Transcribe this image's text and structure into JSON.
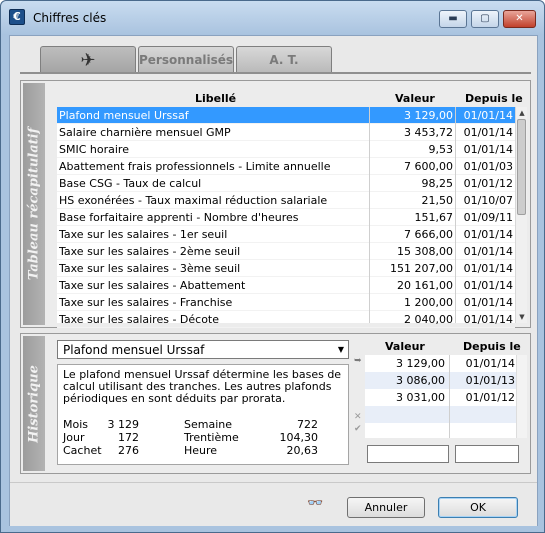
{
  "window": {
    "title": "Chiffres clés",
    "app_icon": "€",
    "controls": {
      "minimize": "▬",
      "maximize": "▢",
      "close": "✕"
    }
  },
  "tabs": [
    {
      "label": "",
      "icon": "airplane-icon",
      "active": true
    },
    {
      "label": "Personnalisés",
      "active": false
    },
    {
      "label": "A. T.",
      "active": false
    }
  ],
  "summary": {
    "side_label": "Tableau récapitulatif",
    "columns": {
      "label": "Libellé",
      "value": "Valeur",
      "since": "Depuis le"
    },
    "rows": [
      {
        "label": "Plafond mensuel Urssaf",
        "value": "3 129,00",
        "since": "01/01/14",
        "selected": true
      },
      {
        "label": "Salaire charnière mensuel GMP",
        "value": "3 453,72",
        "since": "01/01/14"
      },
      {
        "label": "SMIC horaire",
        "value": "9,53",
        "since": "01/01/14"
      },
      {
        "label": "Abattement frais professionnels - Limite annuelle",
        "value": "7 600,00",
        "since": "01/01/03"
      },
      {
        "label": "Base CSG - Taux de calcul",
        "value": "98,25",
        "since": "01/01/12"
      },
      {
        "label": "HS exonérées - Taux maximal réduction salariale",
        "value": "21,50",
        "since": "01/10/07"
      },
      {
        "label": "Base forfaitaire apprenti - Nombre d'heures",
        "value": "151,67",
        "since": "01/09/11"
      },
      {
        "label": "Taxe sur les salaires - 1er seuil",
        "value": "7 666,00",
        "since": "01/01/14"
      },
      {
        "label": "Taxe sur les salaires - 2ème seuil",
        "value": "15 308,00",
        "since": "01/01/14"
      },
      {
        "label": "Taxe sur les salaires - 3ème seuil",
        "value": "151 207,00",
        "since": "01/01/14"
      },
      {
        "label": "Taxe sur les salaires - Abattement",
        "value": "20 161,00",
        "since": "01/01/14"
      },
      {
        "label": "Taxe sur les salaires - Franchise",
        "value": "1 200,00",
        "since": "01/01/14"
      },
      {
        "label": "Taxe sur les salaires - Décote",
        "value": "2 040,00",
        "since": "01/01/14"
      }
    ]
  },
  "history": {
    "side_label": "Historique",
    "selected": "Plafond mensuel Urssaf",
    "description": "Le plafond mensuel Urssaf détermine les bases de calcul utilisant des tranches. Les autres plafonds périodiques en sont déduits par prorata.",
    "periods": [
      {
        "name": "Mois",
        "value": "3 129"
      },
      {
        "name": "Jour",
        "value": "172"
      },
      {
        "name": "Cachet",
        "value": "276"
      },
      {
        "name": "Semaine",
        "value": "722"
      },
      {
        "name": "Trentième",
        "value": "104,30"
      },
      {
        "name": "Heure",
        "value": "20,63"
      }
    ],
    "columns": {
      "value": "Valeur",
      "since": "Depuis le"
    },
    "rows": [
      {
        "value": "3 129,00",
        "since": "01/01/14"
      },
      {
        "value": "3 086,00",
        "since": "01/01/13"
      },
      {
        "value": "3 031,00",
        "since": "01/01/12"
      }
    ],
    "new_value": "",
    "new_since": ""
  },
  "buttons": {
    "cancel": "Annuler",
    "ok": "OK"
  }
}
